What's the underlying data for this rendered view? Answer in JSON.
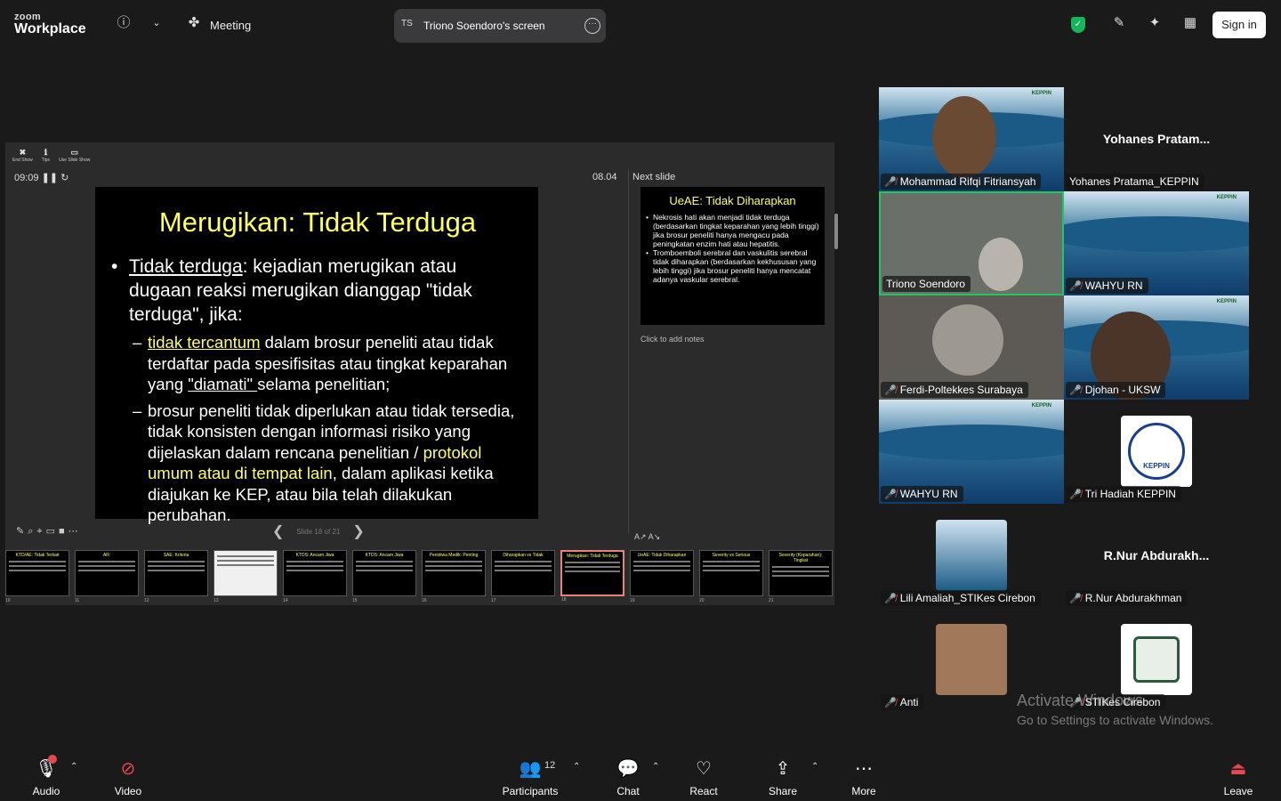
{
  "app": {
    "brand_top": "zoom",
    "brand_bottom": "Workplace",
    "meeting_label": "Meeting",
    "sign_in": "Sign in"
  },
  "screen_share": {
    "initials": "TS",
    "title": "Triono Soendoro's screen"
  },
  "presenter": {
    "tools": [
      {
        "icon": "✖",
        "label": "End Show"
      },
      {
        "icon": "ℹ",
        "label": "Tips"
      },
      {
        "icon": "▭",
        "label": "Use Slide Show"
      }
    ],
    "timer": "09:09",
    "clock": "08.04",
    "next_slide_label": "Next slide",
    "notes_placeholder": "Click to add notes",
    "slide_counter": "Slide 18 of 21"
  },
  "current_slide": {
    "title": "Merugikan: Tidak Terduga",
    "bullet_term": "Tidak terduga",
    "bullet_rest": ": kejadian merugikan atau dugaan reaksi merugikan dianggap \"tidak terduga\", jika:",
    "sub1_term": "tidak tercantum",
    "sub1_a": " dalam brosur peneliti atau tidak terdaftar pada spesifisitas atau tingkat keparahan yang ",
    "sub1_term2": "\"diamati\" ",
    "sub1_b": "selama penelitian;",
    "sub2_a": "brosur peneliti tidak diperlukan atau tidak tersedia, tidak konsisten dengan informasi risiko yang dijelaskan dalam rencana penelitian / ",
    "sub2_yellow": "protokol umum atau di tempat lain",
    "sub2_b": ", dalam aplikasi ketika diajukan ke KEP, atau bila telah dilakukan perubahan."
  },
  "next_slide": {
    "title": "UeAE: Tidak Diharapkan",
    "bullets": [
      "Nekrosis hati akan menjadi tidak terduga (berdasarkan tingkat keparahan yang lebih tinggi) jika brosur peneliti hanya mengacu pada peningkatan enzim hati atau hepatitis.",
      "Tromboemboli serebral dan vaskulitis serebral tidak diharapkan (berdasarkan kekhususan yang lebih tinggi) jika brosur peneliti hanya mencatat adanya vaskular serebral."
    ]
  },
  "thumbnails": [
    {
      "num": "10",
      "title": "KTD/AE: Tidak Terkait"
    },
    {
      "num": "11",
      "title": "AR:"
    },
    {
      "num": "12",
      "title": "SAE: Kriteria"
    },
    {
      "num": "13",
      "title": ""
    },
    {
      "num": "14",
      "title": "KTDS: Ancam Jiwa"
    },
    {
      "num": "15",
      "title": "KTDS: Ancam Jiwa"
    },
    {
      "num": "16",
      "title": "Peristiwa Medik: Penting"
    },
    {
      "num": "17",
      "title": "Diharapkan vs Tidak"
    },
    {
      "num": "18",
      "title": "Merugikan: Tidak Terduga"
    },
    {
      "num": "19",
      "title": "UeAE: Tidak Diharapkan"
    },
    {
      "num": "20",
      "title": "Severity vs Serious"
    },
    {
      "num": "21",
      "title": "Severity (Keparahan): Tingkat"
    }
  ],
  "participants": [
    {
      "name": "Mohammad Rifqi Fitriansyah"
    },
    {
      "name": "Yohanes Pratama_KEPPIN",
      "big": "Yohanes  Pratam..."
    },
    {
      "name": "Triono Soendoro"
    },
    {
      "name": "WAHYU RN"
    },
    {
      "name": "Ferdi-Poltekkes Surabaya"
    },
    {
      "name": "Djohan - UKSW"
    },
    {
      "name": "WAHYU RN"
    },
    {
      "name": "Tri Hadiah KEPPIN"
    },
    {
      "name": "Lili Amaliah_STIKes Cirebon"
    },
    {
      "name": "R.Nur Abdurakhman",
      "big": "R.Nur  Abdurakh..."
    },
    {
      "name": "Anti"
    },
    {
      "name": "STIKes Cirebon"
    }
  ],
  "banner_text": "KEPPIN",
  "keppin_logo": "KEPPIN",
  "watermark": {
    "line1": "Activate Windows",
    "line2": "Go to Settings to activate Windows."
  },
  "bottom": {
    "audio": "Audio",
    "video": "Video",
    "participants": "Participants",
    "participant_count": "12",
    "chat": "Chat",
    "react": "React",
    "share": "Share",
    "more": "More",
    "leave": "Leave"
  }
}
